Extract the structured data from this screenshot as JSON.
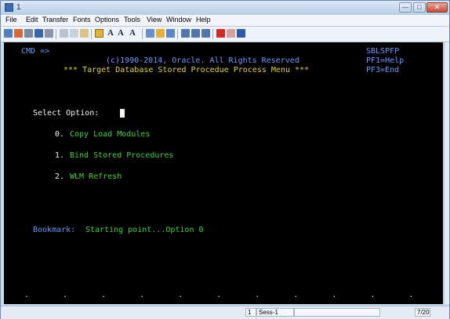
{
  "window": {
    "title": "1",
    "controls": {
      "minimize": "—",
      "maximize": "□",
      "close": "✕"
    }
  },
  "menu": [
    "File",
    "Edit",
    "Transfer",
    "Fonts",
    "Options",
    "Tools",
    "View",
    "Window",
    "Help"
  ],
  "toolbar": {
    "icons": [
      "connect-icon",
      "disconnect-icon",
      "print-icon",
      "save-icon",
      "print-screen-icon",
      "cut-icon",
      "copy-icon",
      "paste-icon",
      "keyboard-icon",
      "font-a-icon",
      "font-smaller-icon",
      "font-larger-icon",
      "macro-icon",
      "record-icon",
      "play-icon",
      "send-file-icon",
      "receive-file-icon",
      "transfer-icon",
      "enter-icon",
      "edit-icon",
      "info-icon"
    ]
  },
  "terminal": {
    "cmd_label": "CMD =>",
    "panel_id": "SBLSPFP",
    "copyright": "(c)1990-2014, Oracle. All Rights Reserved",
    "pf1": "PF1=Help",
    "menu_title": "*** Target Database Stored Procedue Process Menu ***",
    "pf3": "PF3=End",
    "select_label": "Select Option:",
    "options": [
      {
        "num": "0.",
        "label": "Copy Load Modules"
      },
      {
        "num": "1.",
        "label": "Bind Stored Procedures"
      },
      {
        "num": "2.",
        "label": "WLM Refresh"
      }
    ],
    "bookmark_label": "Bookmark:",
    "bookmark_value": "Starting point...Option 0",
    "dots": ". . . . . . . . . . . . . . . . . . . . . . . . . . . ."
  },
  "status": {
    "field1": "1",
    "session": "Sess-1",
    "position": "7/20"
  },
  "colors": {
    "blue": "#6d9aff",
    "yellow": "#e3d23d",
    "green": "#3bd33b",
    "white": "#f5f5f5",
    "background": "#000000"
  }
}
